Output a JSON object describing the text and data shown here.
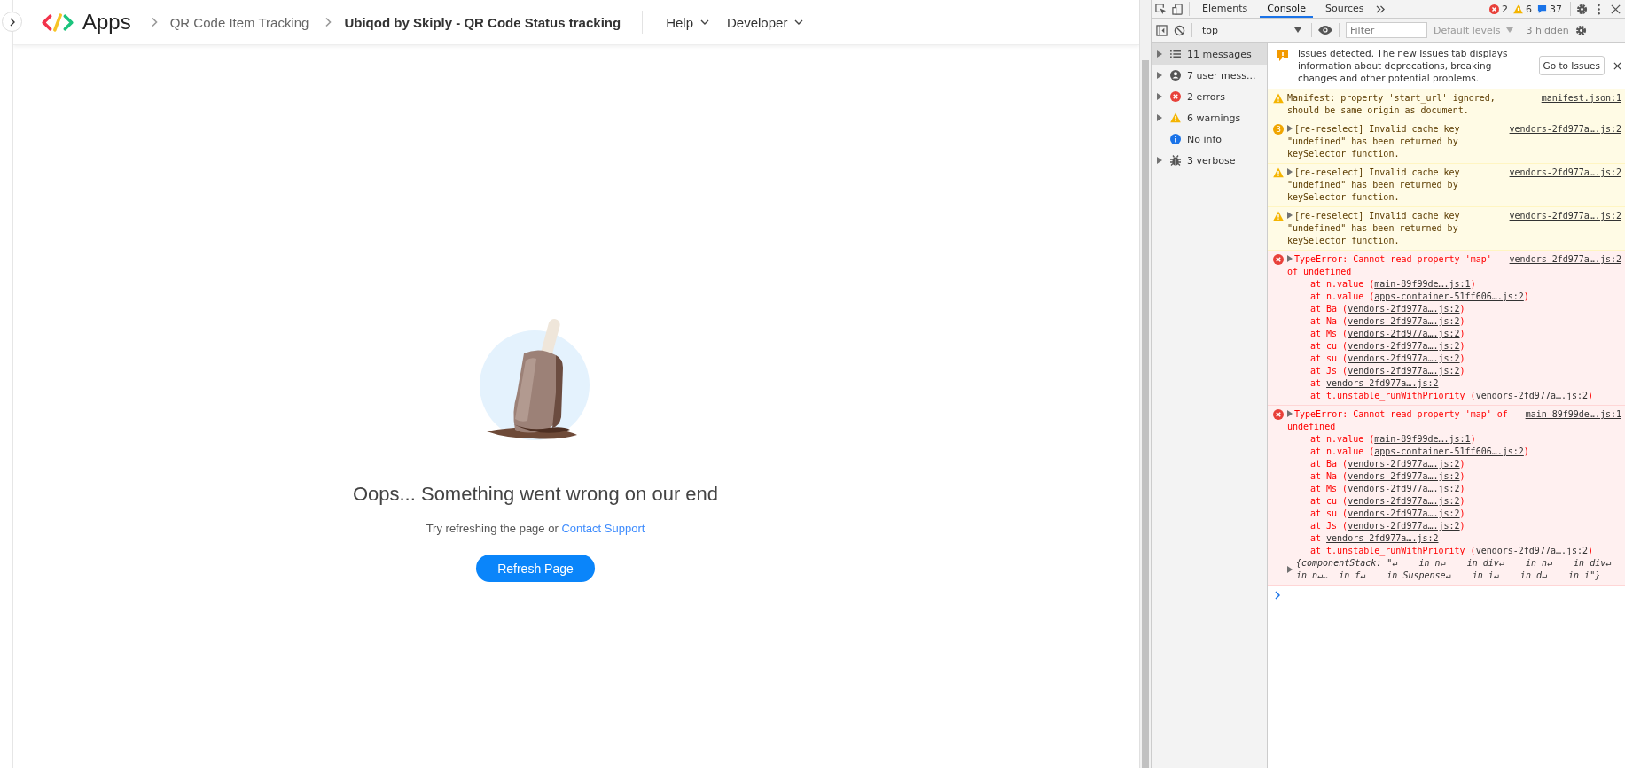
{
  "app": {
    "logo_text": "Apps",
    "breadcrumbs": [
      {
        "label": "QR Code Item Tracking",
        "current": false
      },
      {
        "label": "Ubiqod by Skiply - QR Code Status tracking",
        "current": true
      }
    ],
    "menus": [
      "Help",
      "Developer"
    ],
    "error": {
      "title": "Oops... Something went wrong on our end",
      "message": "Try refreshing the page or",
      "link": "Contact Support",
      "button": "Refresh Page"
    }
  },
  "devtools": {
    "tabs": [
      {
        "label": "Elements",
        "selected": false
      },
      {
        "label": "Console",
        "selected": true
      },
      {
        "label": "Sources",
        "selected": false
      }
    ],
    "counts": {
      "errors": "2",
      "warnings": "6",
      "messages": "37"
    },
    "context": "top",
    "filter": {
      "placeholder": "Filter"
    },
    "levels": "Default levels",
    "hidden": "3 hidden",
    "sidebar": [
      {
        "kind": "all",
        "label": "11 messages",
        "selected": true,
        "expandable": true
      },
      {
        "kind": "user",
        "label": "7 user mess...",
        "selected": false,
        "expandable": true
      },
      {
        "kind": "error",
        "label": "2 errors",
        "selected": false,
        "expandable": true
      },
      {
        "kind": "warning",
        "label": "6 warnings",
        "selected": false,
        "expandable": true
      },
      {
        "kind": "info",
        "label": "No info",
        "selected": false,
        "expandable": false
      },
      {
        "kind": "verbose",
        "label": "3 verbose",
        "selected": false,
        "expandable": true
      }
    ],
    "issues_banner": {
      "text": "Issues detected. The new Issues tab displays information about deprecations, breaking changes and other potential problems.",
      "button": "Go to Issues"
    },
    "messages": [
      {
        "kind": "warning",
        "expandable": false,
        "text": "Manifest: property 'start_url' ignored, should be same origin as document.",
        "source": "manifest.json:1"
      },
      {
        "kind": "warning",
        "repeat": "3",
        "expandable": true,
        "text": "[re-reselect] Invalid cache key \"undefined\" has been returned by keySelector function.",
        "source": "vendors-2fd977a….js:2"
      },
      {
        "kind": "warning",
        "expandable": true,
        "text": "[re-reselect] Invalid cache key \"undefined\" has been returned by keySelector function.",
        "source": "vendors-2fd977a….js:2"
      },
      {
        "kind": "warning",
        "expandable": true,
        "text": "[re-reselect] Invalid cache key \"undefined\" has been returned by keySelector function.",
        "source": "vendors-2fd977a….js:2"
      },
      {
        "kind": "error",
        "expandable": true,
        "text": "TypeError: Cannot read property 'map' of undefined",
        "source": "vendors-2fd977a….js:2",
        "stack": [
          {
            "prefix": "at n.value (",
            "link": "main-89f99de….js:1",
            "suffix": ")"
          },
          {
            "prefix": "at n.value (",
            "link": "apps-container-51ff606….js:2",
            "suffix": ")"
          },
          {
            "prefix": "at Ba (",
            "link": "vendors-2fd977a….js:2",
            "suffix": ")"
          },
          {
            "prefix": "at Na (",
            "link": "vendors-2fd977a….js:2",
            "suffix": ")"
          },
          {
            "prefix": "at Ms (",
            "link": "vendors-2fd977a….js:2",
            "suffix": ")"
          },
          {
            "prefix": "at cu (",
            "link": "vendors-2fd977a….js:2",
            "suffix": ")"
          },
          {
            "prefix": "at su (",
            "link": "vendors-2fd977a….js:2",
            "suffix": ")"
          },
          {
            "prefix": "at Js (",
            "link": "vendors-2fd977a….js:2",
            "suffix": ")"
          },
          {
            "prefix": "at ",
            "link": "vendors-2fd977a….js:2"
          },
          {
            "prefix": "at t.unstable_runWithPriority (",
            "link": "vendors-2fd977a….js:2",
            "suffix": ")"
          }
        ]
      },
      {
        "kind": "error",
        "expandable": true,
        "text": "TypeError: Cannot read property 'map' of undefined",
        "source": "main-89f99de….js:1",
        "stack": [
          {
            "prefix": "at n.value (",
            "link": "main-89f99de….js:1",
            "suffix": ")"
          },
          {
            "prefix": "at n.value (",
            "link": "apps-container-51ff606….js:2",
            "suffix": ")"
          },
          {
            "prefix": "at Ba (",
            "link": "vendors-2fd977a….js:2",
            "suffix": ")"
          },
          {
            "prefix": "at Na (",
            "link": "vendors-2fd977a….js:2",
            "suffix": ")"
          },
          {
            "prefix": "at Ms (",
            "link": "vendors-2fd977a….js:2",
            "suffix": ")"
          },
          {
            "prefix": "at cu (",
            "link": "vendors-2fd977a….js:2",
            "suffix": ")"
          },
          {
            "prefix": "at su (",
            "link": "vendors-2fd977a….js:2",
            "suffix": ")"
          },
          {
            "prefix": "at Js (",
            "link": "vendors-2fd977a….js:2",
            "suffix": ")"
          },
          {
            "prefix": "at ",
            "link": "vendors-2fd977a….js:2"
          },
          {
            "prefix": "at t.unstable_runWithPriority (",
            "link": "vendors-2fd977a….js:2",
            "suffix": ")"
          }
        ],
        "object": "{componentStack: \"↵    in n↵    in div↵    in n↵    in div↵    in n↵…  in f↵    in Suspense↵    in i↵    in d↵    in i\"}"
      }
    ]
  }
}
